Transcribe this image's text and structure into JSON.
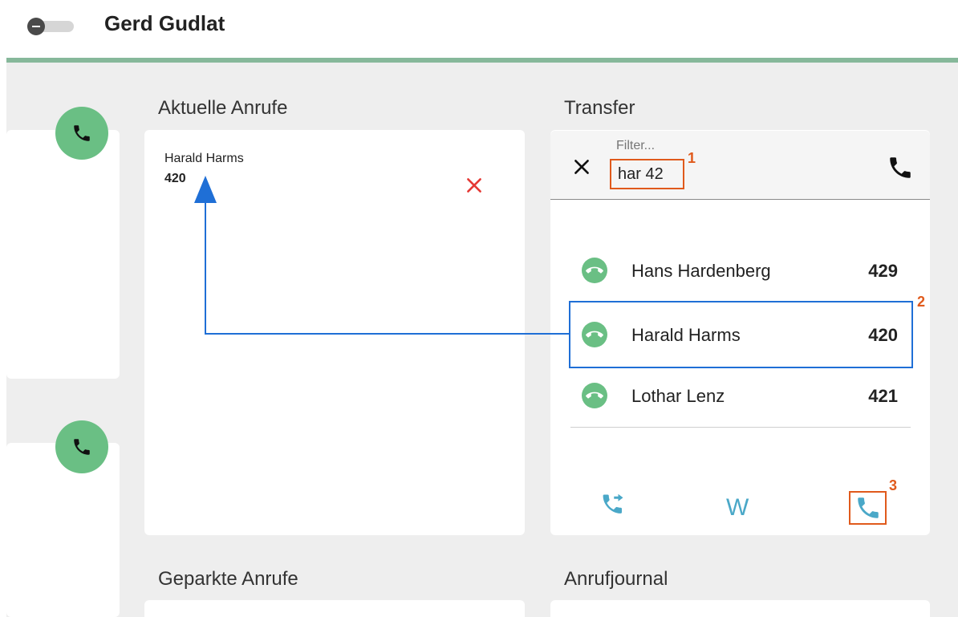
{
  "header": {
    "user_name": "Gerd Gudlat",
    "toggle_state": "off"
  },
  "colors": {
    "accent_line": "#86b89a",
    "call_green": "#6abf84",
    "annotation_orange": "#e05a1c",
    "annotation_blue": "#1f6fd6",
    "action_teal": "#4aa8c8",
    "reject_red": "#e53935"
  },
  "sidebar": {
    "buttons": [
      {
        "icon": "phone-icon"
      },
      {
        "icon": "phone-icon"
      }
    ]
  },
  "current_calls": {
    "title": "Aktuelle Anrufe",
    "calls": [
      {
        "name": "Harald Harms",
        "number": "420",
        "reject_icon": "close-icon"
      }
    ]
  },
  "transfer": {
    "title": "Transfer",
    "filter": {
      "label": "Filter...",
      "value": "har 42",
      "badge": "1"
    },
    "contacts": [
      {
        "name": "Hans Hardenberg",
        "number": "429"
      },
      {
        "name": "Harald Harms",
        "number": "420",
        "badge": "2"
      },
      {
        "name": "Lothar Lenz",
        "number": "421"
      }
    ],
    "actions": {
      "transfer_icon": "call-transfer-icon",
      "w_label": "W",
      "call_icon": "phone-icon",
      "call_badge": "3"
    }
  },
  "parked_calls": {
    "title": "Geparkte Anrufe"
  },
  "journal": {
    "title": "Anrufjournal"
  }
}
